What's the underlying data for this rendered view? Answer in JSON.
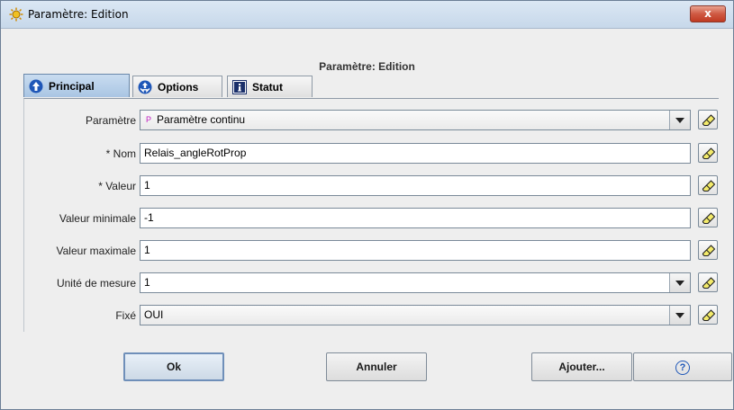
{
  "window": {
    "title": "Paramètre: Edition",
    "close_label": "x",
    "app_icon": "sun-icon"
  },
  "dialog": {
    "heading": "Paramètre: Edition"
  },
  "tabs": [
    {
      "label": "Principal",
      "icon": "arrow-up-circle-icon",
      "active": true
    },
    {
      "label": "Options",
      "icon": "options-circle-icon",
      "active": false
    },
    {
      "label": "Statut",
      "icon": "info-icon",
      "active": false
    }
  ],
  "form": {
    "parametre": {
      "label": "Paramètre",
      "prefix": "P",
      "value": "Paramètre continu"
    },
    "nom": {
      "label": "* Nom",
      "value": "Relais_angleRotProp"
    },
    "valeur": {
      "label": "* Valeur",
      "value": "1"
    },
    "valeur_min": {
      "label": "Valeur minimale",
      "value": "-1"
    },
    "valeur_max": {
      "label": "Valeur maximale",
      "value": "1"
    },
    "unite": {
      "label": "Unité de mesure",
      "value": "1"
    },
    "fixe": {
      "label": "Fixé",
      "value": "OUI"
    }
  },
  "buttons": {
    "ok": "Ok",
    "annuler": "Annuler",
    "ajouter": "Ajouter...",
    "help": "?"
  },
  "colors": {
    "active_tab": "#a9c5e3",
    "close_button": "#c03a22",
    "param_prefix": "#c020c0"
  }
}
